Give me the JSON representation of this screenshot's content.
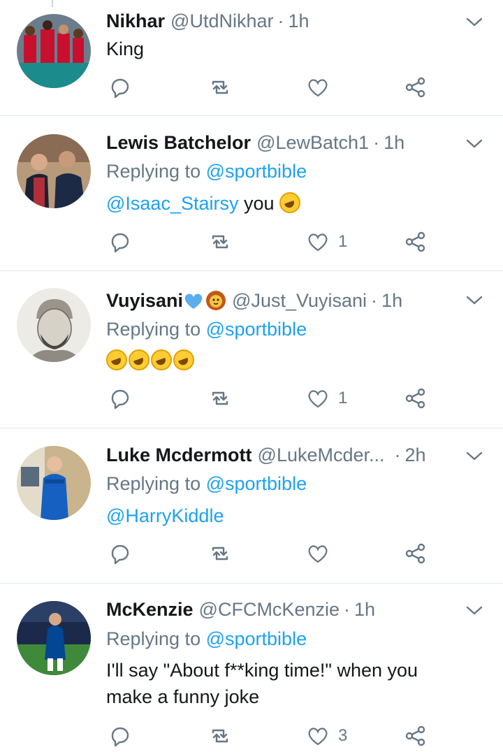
{
  "colors": {
    "link": "#1da1f2",
    "muted": "#657786",
    "text": "#14171a",
    "divider": "#e1e8ed"
  },
  "tweets": [
    {
      "name": "Nikhar",
      "handle": "@UtdNikhar",
      "dot": "·",
      "time": "1h",
      "text": "King",
      "likes": ""
    },
    {
      "name": "Lewis Batchelor",
      "handle": "@LewBatch1",
      "dot": "·",
      "time": "1h",
      "reply_prefix": "Replying to",
      "reply_to": "@sportbible",
      "mention": "@Isaac_Stairsy",
      "text": "you",
      "emoji": "rolling-on-floor-laughing",
      "likes": "1"
    },
    {
      "name": "Vuyisani",
      "name_emojis": [
        "blue-heart",
        "lion-face"
      ],
      "handle": "@Just_Vuyisani",
      "dot": "·",
      "time": "1h",
      "reply_prefix": "Replying to",
      "reply_to": "@sportbible",
      "emoji": "rolling-on-floor-laughing x4",
      "likes": "1"
    },
    {
      "name": "Luke Mcdermott",
      "handle": "@LukeMcder...",
      "dot": "·",
      "time": "2h",
      "reply_prefix": "Replying to",
      "reply_to": "@sportbible",
      "mention": "@HarryKiddle",
      "likes": ""
    },
    {
      "name": "McKenzie",
      "handle": "@CFCMcKenzie",
      "dot": "·",
      "time": "1h",
      "reply_prefix": "Replying to",
      "reply_to": "@sportbible",
      "text_line1": "I'll say \"About f**king time!\" when you",
      "text_line2": "make a funny joke",
      "likes": "3"
    }
  ]
}
